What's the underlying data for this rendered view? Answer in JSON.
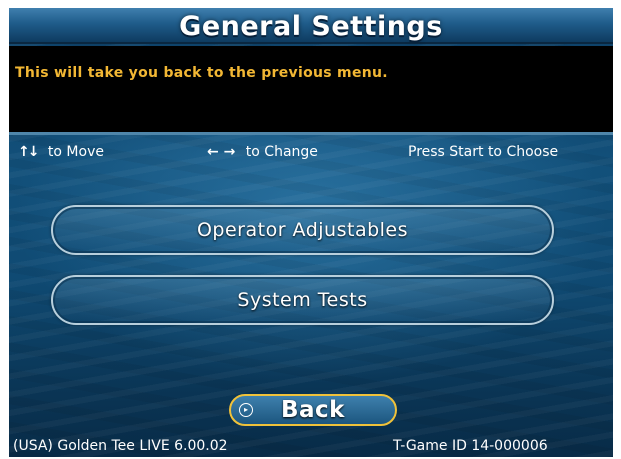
{
  "header": {
    "title": "General Settings"
  },
  "help": {
    "text": "This will take you back to the previous menu."
  },
  "hints": {
    "move_icon": "↑↓",
    "move_label": "to Move",
    "change_icon": "← →",
    "change_label": "to Change",
    "choose_label": "Press Start to Choose"
  },
  "menu": {
    "items": [
      {
        "label": "Operator Adjustables"
      },
      {
        "label": "System Tests"
      }
    ],
    "back_label": "Back"
  },
  "footer": {
    "version": "(USA) Golden Tee LIVE 6.00.02",
    "game_id": "T-Game ID 14-000006"
  },
  "colors": {
    "help_text": "#f2b734",
    "back_border": "#f0c23a",
    "background": "#12507a"
  }
}
